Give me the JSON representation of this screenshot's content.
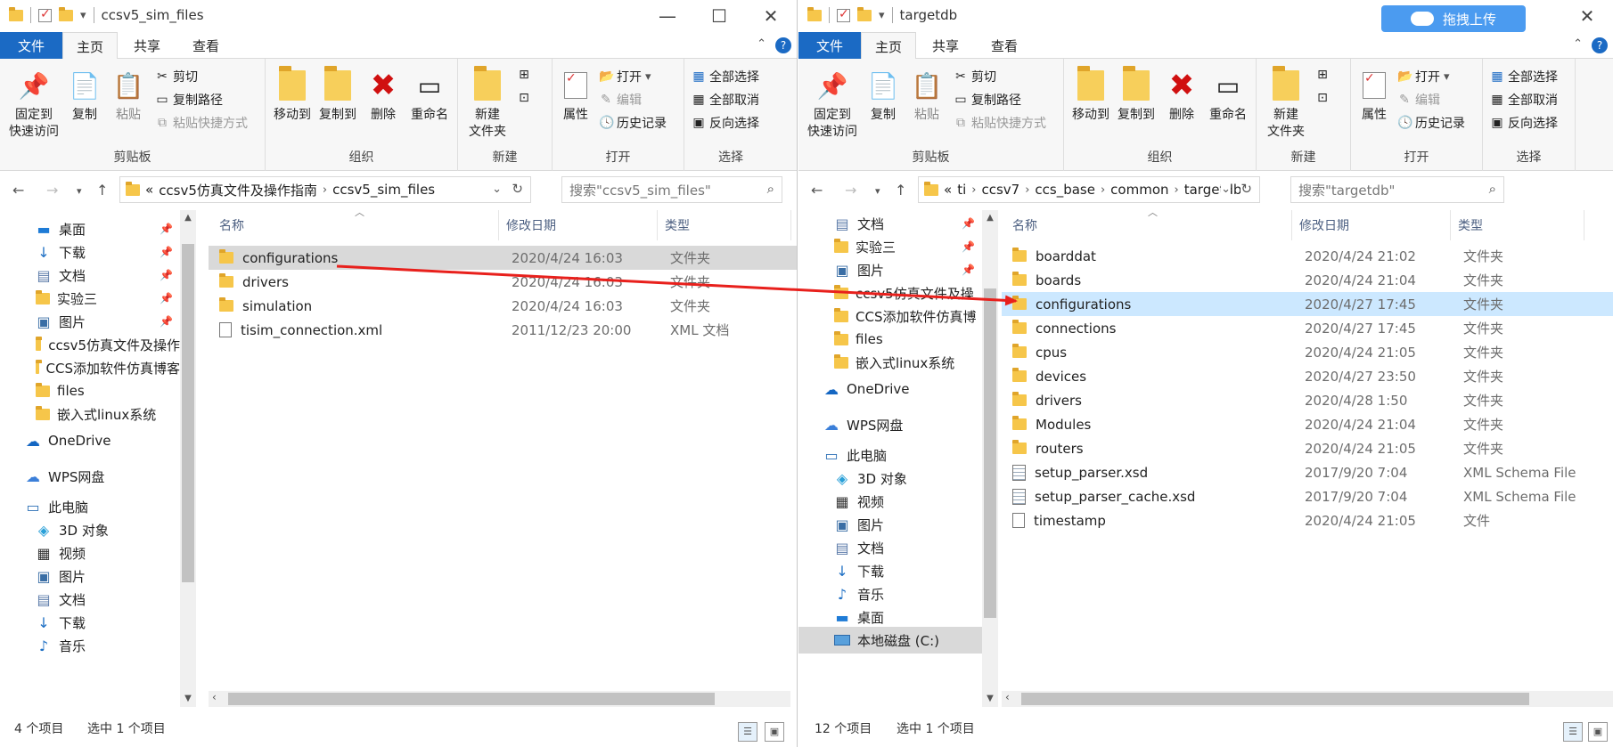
{
  "left": {
    "title": "ccsv5_sim_files",
    "tabs": {
      "file": "文件",
      "home": "主页",
      "share": "共享",
      "view": "查看"
    },
    "ribbon": {
      "clipboard": {
        "label": "剪贴板",
        "pin": "固定到\n快速访问",
        "copy": "复制",
        "paste": "粘贴",
        "cut": "剪切",
        "copy_path": "复制路径",
        "paste_shortcut": "粘贴快捷方式"
      },
      "organize": {
        "label": "组织",
        "move_to": "移动到",
        "copy_to": "复制到",
        "delete": "删除",
        "rename": "重命名"
      },
      "new": {
        "label": "新建",
        "new_folder": "新建\n文件夹"
      },
      "open": {
        "label": "打开",
        "properties": "属性",
        "open": "打开",
        "edit": "编辑",
        "history": "历史记录"
      },
      "select": {
        "label": "选择",
        "select_all": "全部选择",
        "select_none": "全部取消",
        "invert": "反向选择"
      }
    },
    "address": {
      "prefix": "«",
      "crumbs": [
        "ccsv5仿真文件及操作指南",
        "ccsv5_sim_files"
      ]
    },
    "search_placeholder": "搜索\"ccsv5_sim_files\"",
    "nav": [
      {
        "label": "桌面",
        "icon": "desktop-icon",
        "pinned": true
      },
      {
        "label": "下载",
        "icon": "download-icon",
        "pinned": true
      },
      {
        "label": "文档",
        "icon": "document-icon",
        "pinned": true
      },
      {
        "label": "实验三",
        "icon": "folder-icon",
        "pinned": true
      },
      {
        "label": "图片",
        "icon": "picture-icon",
        "pinned": true
      },
      {
        "label": "ccsv5仿真文件及操作",
        "icon": "folder-icon",
        "pinned": false
      },
      {
        "label": "CCS添加软件仿真博客",
        "icon": "folder-icon",
        "pinned": false
      },
      {
        "label": "files",
        "icon": "folder-icon",
        "pinned": false
      },
      {
        "label": "嵌入式linux系统",
        "icon": "folder-icon",
        "pinned": false
      },
      {
        "label": "OneDrive",
        "icon": "onedrive-icon",
        "pinned": false
      },
      {
        "label": "WPS网盘",
        "icon": "wps-cloud-icon",
        "pinned": false
      },
      {
        "label": "此电脑",
        "icon": "computer-icon",
        "pinned": false
      },
      {
        "label": "3D 对象",
        "icon": "3d-objects-icon",
        "pinned": false
      },
      {
        "label": "视频",
        "icon": "video-icon",
        "pinned": false
      },
      {
        "label": "图片",
        "icon": "picture-icon",
        "pinned": false
      },
      {
        "label": "文档",
        "icon": "document-icon",
        "pinned": false
      },
      {
        "label": "下载",
        "icon": "download-icon",
        "pinned": false
      },
      {
        "label": "音乐",
        "icon": "music-icon",
        "pinned": false
      }
    ],
    "columns": {
      "name": "名称",
      "date": "修改日期",
      "type": "类型"
    },
    "files": [
      {
        "name": "configurations",
        "date": "2020/4/24 16:03",
        "type": "文件夹",
        "kind": "folder"
      },
      {
        "name": "drivers",
        "date": "2020/4/24 16:03",
        "type": "文件夹",
        "kind": "folder"
      },
      {
        "name": "simulation",
        "date": "2020/4/24 16:03",
        "type": "文件夹",
        "kind": "folder"
      },
      {
        "name": "tisim_connection.xml",
        "date": "2011/12/23 20:00",
        "type": "XML 文档",
        "kind": "file"
      }
    ],
    "status": {
      "count": "4 个项目",
      "selected": "选中 1 个项目"
    }
  },
  "right": {
    "title": "targetdb",
    "upload_label": "拖拽上传",
    "tabs": {
      "file": "文件",
      "home": "主页",
      "share": "共享",
      "view": "查看"
    },
    "ribbon": {
      "clipboard": {
        "label": "剪贴板",
        "pin": "固定到\n快速访问",
        "copy": "复制",
        "paste": "粘贴",
        "cut": "剪切",
        "copy_path": "复制路径",
        "paste_shortcut": "粘贴快捷方式"
      },
      "organize": {
        "label": "组织",
        "move_to": "移动到",
        "copy_to": "复制到",
        "delete": "删除",
        "rename": "重命名"
      },
      "new": {
        "label": "新建",
        "new_folder": "新建\n文件夹"
      },
      "open": {
        "label": "打开",
        "properties": "属性",
        "open": "打开",
        "edit": "编辑",
        "history": "历史记录"
      },
      "select": {
        "label": "选择",
        "select_all": "全部选择",
        "select_none": "全部取消",
        "invert": "反向选择"
      }
    },
    "address": {
      "prefix": "«",
      "crumbs": [
        "ti",
        "ccsv7",
        "ccs_base",
        "common",
        "targetdb"
      ]
    },
    "search_placeholder": "搜索\"targetdb\"",
    "nav": [
      {
        "label": "文档",
        "icon": "document-icon",
        "pinned": true
      },
      {
        "label": "实验三",
        "icon": "folder-icon",
        "pinned": true
      },
      {
        "label": "图片",
        "icon": "picture-icon",
        "pinned": true
      },
      {
        "label": "ccsv5仿真文件及操",
        "icon": "folder-icon",
        "pinned": false
      },
      {
        "label": "CCS添加软件仿真博",
        "icon": "folder-icon",
        "pinned": false
      },
      {
        "label": "files",
        "icon": "folder-icon",
        "pinned": false
      },
      {
        "label": "嵌入式linux系统",
        "icon": "folder-icon",
        "pinned": false
      },
      {
        "label": "OneDrive",
        "icon": "onedrive-icon",
        "pinned": false
      },
      {
        "label": "WPS网盘",
        "icon": "wps-cloud-icon",
        "pinned": false
      },
      {
        "label": "此电脑",
        "icon": "computer-icon",
        "pinned": false
      },
      {
        "label": "3D 对象",
        "icon": "3d-objects-icon",
        "pinned": false
      },
      {
        "label": "视频",
        "icon": "video-icon",
        "pinned": false
      },
      {
        "label": "图片",
        "icon": "picture-icon",
        "pinned": false
      },
      {
        "label": "文档",
        "icon": "document-icon",
        "pinned": false
      },
      {
        "label": "下载",
        "icon": "download-icon",
        "pinned": false
      },
      {
        "label": "音乐",
        "icon": "music-icon",
        "pinned": false
      },
      {
        "label": "桌面",
        "icon": "desktop-icon",
        "pinned": false
      },
      {
        "label": "本地磁盘 (C:)",
        "icon": "drive-icon",
        "pinned": false
      }
    ],
    "columns": {
      "name": "名称",
      "date": "修改日期",
      "type": "类型"
    },
    "files": [
      {
        "name": "boarddat",
        "date": "2020/4/24 21:02",
        "type": "文件夹",
        "kind": "folder"
      },
      {
        "name": "boards",
        "date": "2020/4/24 21:04",
        "type": "文件夹",
        "kind": "folder"
      },
      {
        "name": "configurations",
        "date": "2020/4/27 17:45",
        "type": "文件夹",
        "kind": "folder"
      },
      {
        "name": "connections",
        "date": "2020/4/27 17:45",
        "type": "文件夹",
        "kind": "folder"
      },
      {
        "name": "cpus",
        "date": "2020/4/24 21:05",
        "type": "文件夹",
        "kind": "folder"
      },
      {
        "name": "devices",
        "date": "2020/4/27 23:50",
        "type": "文件夹",
        "kind": "folder"
      },
      {
        "name": "drivers",
        "date": "2020/4/28 1:50",
        "type": "文件夹",
        "kind": "folder"
      },
      {
        "name": "Modules",
        "date": "2020/4/24 21:04",
        "type": "文件夹",
        "kind": "folder"
      },
      {
        "name": "routers",
        "date": "2020/4/24 21:05",
        "type": "文件夹",
        "kind": "folder"
      },
      {
        "name": "setup_parser.xsd",
        "date": "2017/9/20 7:04",
        "type": "XML Schema File",
        "kind": "xsd"
      },
      {
        "name": "setup_parser_cache.xsd",
        "date": "2017/9/20 7:04",
        "type": "XML Schema File",
        "kind": "xsd"
      },
      {
        "name": "timestamp",
        "date": "2020/4/24 21:05",
        "type": "文件",
        "kind": "file"
      }
    ],
    "status": {
      "count": "12 个项目",
      "selected": "选中 1 个项目"
    }
  },
  "colors": {
    "accent": "#1b6ac4",
    "selection": "#cce8ff",
    "folder": "#f6c64a",
    "arrow": "#e8201c"
  }
}
